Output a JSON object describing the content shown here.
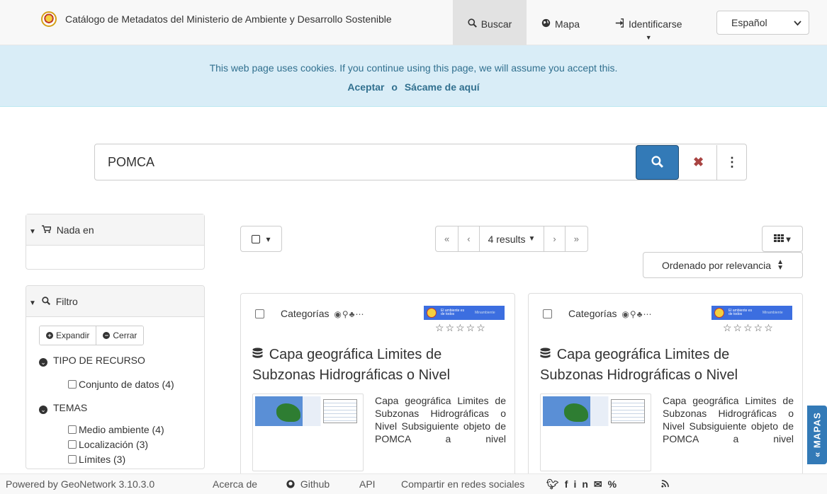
{
  "header": {
    "title": "Catálogo de Metadatos del Ministerio de Ambiente y Desarrollo Sostenible",
    "nav": {
      "search": "Buscar",
      "map": "Mapa",
      "login": "Identificarse"
    },
    "language": "Español"
  },
  "cookie_banner": {
    "text": "This web page uses cookies. If you continue using this page, we will assume you accept this.",
    "accept": "Aceptar",
    "or": "o",
    "leave": "Sácame de aquí"
  },
  "search": {
    "value": "POMCA"
  },
  "sidebar": {
    "nada_panel": {
      "title": "Nada en"
    },
    "filter_panel": {
      "title": "Filtro",
      "expand": "Expandir",
      "collapse": "Cerrar",
      "facets": [
        {
          "title": "TIPO DE RECURSO",
          "items": [
            "Conjunto de datos (4)"
          ]
        },
        {
          "title": "TEMAS",
          "items": [
            "Medio ambiente (4)",
            "Localización (3)",
            "Límites (3)"
          ]
        }
      ]
    }
  },
  "results": {
    "count_label": "4 results",
    "sort_label": "Ordenado por relevancia",
    "pager": {
      "first": "«",
      "prev": "‹",
      "next": "›",
      "last": "»"
    },
    "cards": [
      {
        "category_label": "Categorías",
        "logo_text": "El ambiente es de todos",
        "logo_text2": "Minambiente",
        "stars": "☆☆☆☆☆",
        "title": "Capa geográfica Limites de Subzonas Hidrográficas o Nivel",
        "description": "Capa geográfica Limites de Subzonas Hidrográficas o Nivel Subsiguiente objeto de POMCA a nivel"
      },
      {
        "category_label": "Categorías",
        "logo_text": "El ambiente es de todos",
        "logo_text2": "Minambiente",
        "stars": "☆☆☆☆☆",
        "title": "Capa geográfica Limites de Subzonas Hidrográficas o Nivel",
        "description": "Capa geográfica Limites de Subzonas Hidrográficas o Nivel Subsiguiente objeto de POMCA a nivel"
      }
    ]
  },
  "side_tab": {
    "label": "« MAPAS"
  },
  "footer": {
    "powered": "Powered by GeoNetwork 3.10.3.0",
    "about": "Acerca de",
    "github": "Github",
    "api": "API",
    "share": "Compartir en redes sociales"
  },
  "colors": {
    "primary": "#337ab7",
    "cookie_bg": "#d9edf7",
    "cookie_text": "#31708f",
    "clear": "#a94442"
  }
}
